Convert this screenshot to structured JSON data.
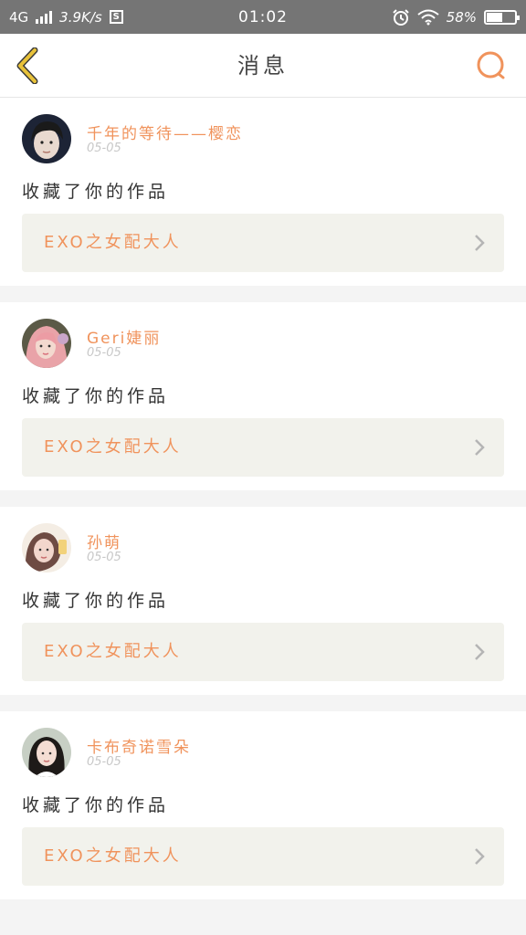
{
  "status_bar": {
    "network": "4G",
    "speed": "3.9K/s",
    "s_badge": "S",
    "time": "01:02",
    "battery": "58%",
    "battery_level": 0.58
  },
  "header": {
    "title": "消息",
    "back_icon": "chevron-left-icon",
    "search_icon": "search-icon"
  },
  "colors": {
    "accent": "#f0935c",
    "back": "#e8c23a",
    "card_box": "#f2f2ec"
  },
  "messages": [
    {
      "username": "千年的等待——樱恋",
      "date": "05-05",
      "action": "收藏了你的作品",
      "work_title": "EXO之女配大人"
    },
    {
      "username": "Geri婕丽",
      "date": "05-05",
      "action": "收藏了你的作品",
      "work_title": "EXO之女配大人"
    },
    {
      "username": "孙萌",
      "date": "05-05",
      "action": "收藏了你的作品",
      "work_title": "EXO之女配大人"
    },
    {
      "username": "卡布奇诺雪朵",
      "date": "05-05",
      "action": "收藏了你的作品",
      "work_title": "EXO之女配大人"
    }
  ]
}
